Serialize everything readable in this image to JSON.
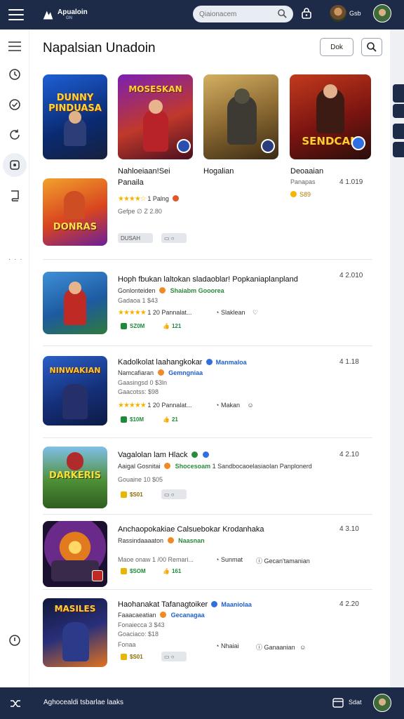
{
  "header": {
    "logo_text": "Apualoin",
    "logo_sub": "GN",
    "search_placeholder": "Qiaionacem",
    "user_label": "Gsb"
  },
  "page": {
    "title": "Napalsian Unadoin",
    "button_label": "Dok"
  },
  "top_grid": [
    {
      "art": "DUNNY PINDUASA",
      "name": "",
      "sub": ""
    },
    {
      "art": "MOSESKAN",
      "name": "Nahloeiaan!Sei",
      "sub": "Panaila",
      "rating": "1 Palng",
      "meta": "Gefpe ∅ Z 2.80",
      "tag": "DUSAH"
    },
    {
      "art": "",
      "name": "Hogalian",
      "sub": ""
    },
    {
      "art": "SENDCAN",
      "name": "Deoaaian",
      "sub": "Panapas",
      "size": "4 1.019",
      "price": "S89"
    }
  ],
  "second_row_item": {
    "art": "DONRAS"
  },
  "list": [
    {
      "art": "",
      "title": "Hoph fbukan laltokan sladaoblar! Popkaniaplanpland",
      "size": "4 2.010",
      "line2a": "Gonlonteiden",
      "line2b": "Shaiabm Gooorea",
      "line3": "Gadaoa 1 $43",
      "rating_text": "1 20  Pannalat...",
      "action1": "Slaklean",
      "price": "SZ0M",
      "count": "121"
    },
    {
      "art": "NINWAKIAN",
      "title": "Kadolkolat laahangkokar",
      "badge": "Manmaloa",
      "size": "4 1.18",
      "line2a": "Namcafiaran",
      "line2b": "Gemngniaa",
      "line3": "Gaasingsd 0 $3ln",
      "line3b": "Gaacotss: $98",
      "rating_text": "1 20  Pannalat...",
      "action1": "Makan",
      "price": "$10M",
      "count": "21"
    },
    {
      "art": "DARKERIS",
      "title": "Vagalolan lam Hlack",
      "size": "4 2.10",
      "line2a": "Aaigal Gosnitai",
      "line2b": "Shocesoam",
      "line2c": "1 Sandbocaoelasiaolan Panplonerd",
      "line3": "Gouaine 10 $05",
      "price": "$S01"
    },
    {
      "art": "",
      "title": "Anchaopokakiae Calsuebokar Krodanhaka",
      "size": "4 3.10",
      "line2a": "Rassindaaaaton",
      "line2b": "Naasnan",
      "line3": "Maoe onaw 1 /00 Remari...",
      "action1": "Sunmat",
      "action2": "Gecan'tamanian",
      "price": "$SOM",
      "count": "161"
    },
    {
      "art": "MASILES",
      "title": "Haohanakat Tafanagtoiker",
      "badge": "Maaniolaa",
      "size": "4 2.20",
      "line2a": "Faaacaeatian",
      "line2b": "Gecanagaa",
      "line3": "Fonaiecca 3 $43",
      "line3b": "Goaciaco: $18",
      "line4": "Fonaa",
      "action1": "Nhaiai",
      "action2": "Ganaanian",
      "price": "$S01"
    }
  ],
  "footer": {
    "text": "Aghocealdi tsbarlae laaks",
    "user": "Sdat"
  }
}
